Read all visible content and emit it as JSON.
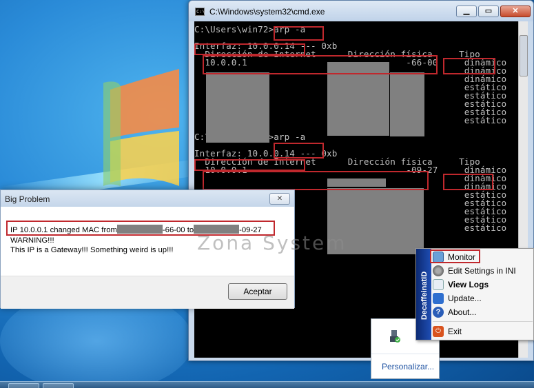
{
  "cmd": {
    "title": "C:\\Windows\\system32\\cmd.exe",
    "lines": [
      "C:\\Users\\win72>arp -a",
      "",
      "Interfaz: 10.0.0.14 --- 0xb",
      "  Dirección de Internet      Dirección física     Tipo",
      "  10.0.0.1                              -66-00     dinámico",
      "                                                   dinámico",
      "                                                   dinámico",
      "                                                   estático",
      "                                                   estático",
      "                                                   estático",
      "                                                   estático",
      "                                                   estático",
      "",
      "C:\\Users\\win72>arp -a",
      "",
      "Interfaz: 10.0.0.14 --- 0xb",
      "  Dirección de Internet      Dirección física     Tipo",
      "  10.0.0.1                              -09-27     dinámico",
      "                                                   dinámico",
      "                                                   dinámico",
      "                                                   estático",
      "                                                   estático",
      "                                                   estático",
      "                                                   estático",
      "                                                   estático"
    ]
  },
  "dialog": {
    "title": "Big Problem",
    "line1_prefix": "IP 10.0.0.1 changed MAC from",
    "line1_mid": "-66-00 to",
    "line1_suffix": "-09-27",
    "line2": "WARNING!!!",
    "line3": "This IP is a Gateway!!! Something weird is up!!!",
    "button": "Aceptar"
  },
  "watermark": "Zona System",
  "tray": {
    "link": "Personalizar..."
  },
  "context_menu": {
    "sidebar_label": "DecaffeinatID",
    "items": [
      {
        "label": "Monitor",
        "icon": "monitor-icon"
      },
      {
        "label": "Edit Settings in INI",
        "icon": "gear-icon"
      },
      {
        "label": "View Logs",
        "icon": "search-icon"
      },
      {
        "label": "Update...",
        "icon": "update-icon"
      },
      {
        "label": "About...",
        "icon": "help-icon"
      },
      {
        "label": "Exit",
        "icon": "exit-icon"
      }
    ]
  },
  "colors": {
    "highlight": "#c0282d",
    "redaction": "#808080",
    "console_text": "#c0c0c0"
  }
}
